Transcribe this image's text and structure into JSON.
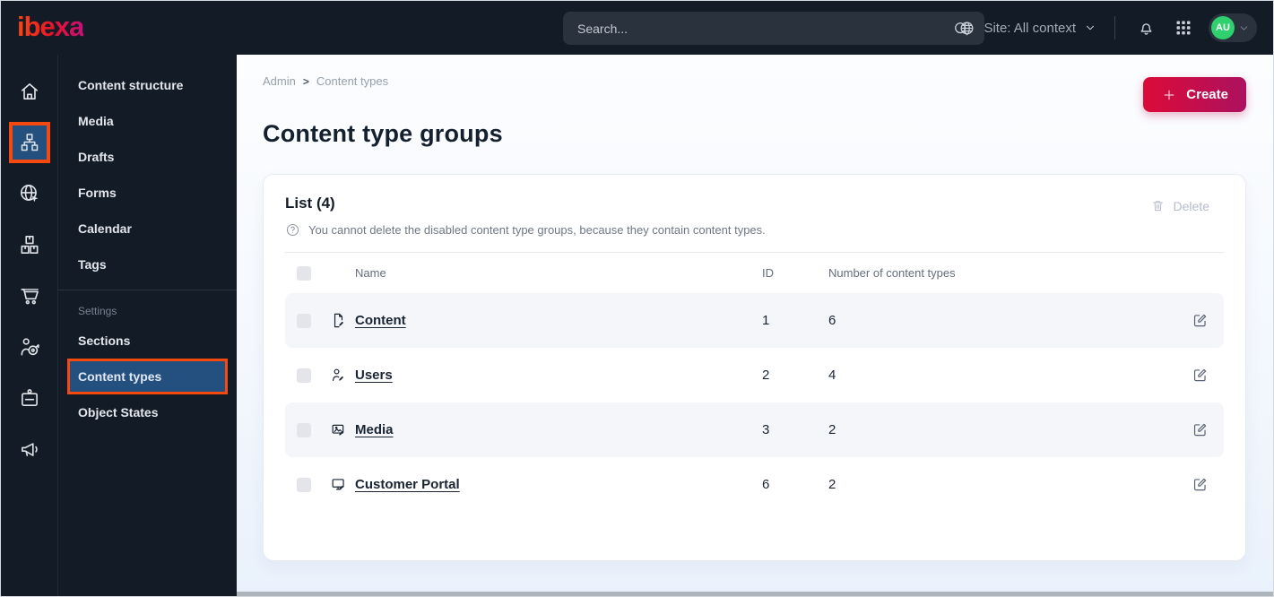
{
  "topbar": {
    "logo": "ibexa",
    "search_placeholder": "Search...",
    "site_selector": "Site: All context",
    "avatar_initials": "AU"
  },
  "rail": {
    "items": [
      {
        "icon": "home-icon",
        "active": false
      },
      {
        "icon": "content-structure-icon",
        "active": true
      },
      {
        "icon": "site-globe-icon",
        "active": false
      },
      {
        "icon": "product-catalog-icon",
        "active": false
      },
      {
        "icon": "commerce-cart-icon",
        "active": false
      },
      {
        "icon": "personalization-icon",
        "active": false
      },
      {
        "icon": "admin-badge-icon",
        "active": false
      },
      {
        "icon": "marketing-megaphone-icon",
        "active": false
      }
    ]
  },
  "sidebar": {
    "items": [
      "Content structure",
      "Media",
      "Drafts",
      "Forms",
      "Calendar",
      "Tags"
    ],
    "settings_label": "Settings",
    "settings_items": [
      "Sections",
      "Content types",
      "Object States"
    ],
    "active_item": "Content types"
  },
  "main": {
    "breadcrumb": [
      "Admin",
      "Content types"
    ],
    "create_label": "Create",
    "title": "Content type groups",
    "card": {
      "title": "List (4)",
      "note": "You cannot delete the disabled content type groups, because they contain content types.",
      "delete_label": "Delete",
      "columns": {
        "name": "Name",
        "id": "ID",
        "count": "Number of content types"
      },
      "rows": [
        {
          "name": "Content",
          "id": "1",
          "count": "6",
          "icon": "file-edit-icon"
        },
        {
          "name": "Users",
          "id": "2",
          "count": "4",
          "icon": "user-edit-icon"
        },
        {
          "name": "Media",
          "id": "3",
          "count": "2",
          "icon": "image-edit-icon"
        },
        {
          "name": "Customer Portal",
          "id": "6",
          "count": "2",
          "icon": "monitor-edit-icon"
        }
      ]
    }
  },
  "colors": {
    "topbar_bg": "#131c26",
    "active_blue": "#24507f",
    "highlight_orange": "#f4490f",
    "create_gradient_start": "#dc0b38",
    "create_gradient_end": "#ac115f",
    "avatar_green": "#2fd06e",
    "stripe_row": "#f4f6f9"
  }
}
